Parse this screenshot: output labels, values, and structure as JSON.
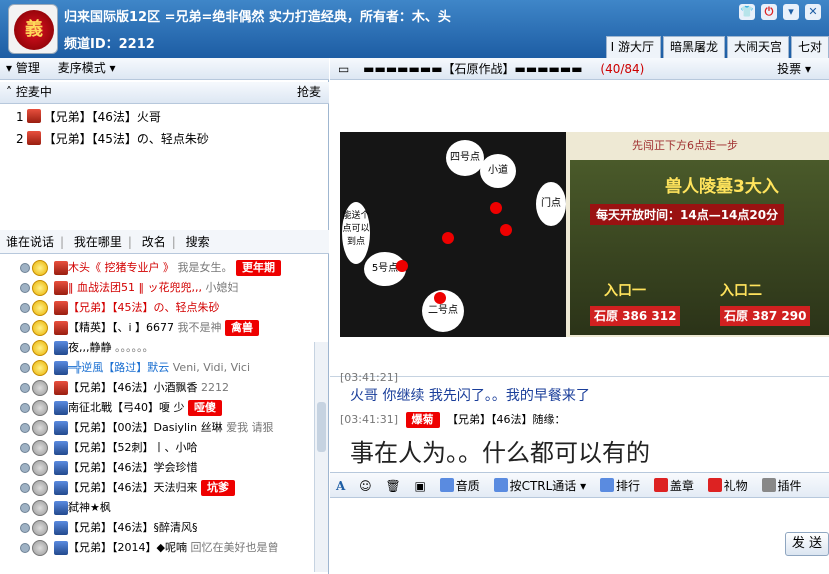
{
  "header": {
    "logo_text": "義",
    "channel_title": "归来国际版12区 =兄弟=绝非偶然 实力打造经典，所有者：木、头",
    "channel_id_label": "频道ID：2212",
    "window_buttons": [
      "shirt-icon",
      "power-icon",
      "minimize-icon",
      "close-icon"
    ],
    "tabs": [
      "I 游大厅",
      "暗黑屠龙",
      "大闹天宫",
      "七对"
    ]
  },
  "left": {
    "manage_label": "管理",
    "mode_label": "麦序模式 ▾",
    "mic_queue_label": "控麦中",
    "grab_mic_label": "抢麦",
    "mic_queue": [
      {
        "index": "1",
        "text": "【兄弟】【46法】火哥"
      },
      {
        "index": "2",
        "text": "【兄弟】【45法】の、轻点朱砂"
      }
    ],
    "chat_tabs": [
      "谁在说话",
      "我在哪里",
      "改名",
      "搜索"
    ],
    "users": [
      {
        "name": "木头《 挖猪专业户 》",
        "extra": "我是女生。",
        "badge": "更年期",
        "name_red": true
      },
      {
        "name": "‖ 血战法团51 ‖ ッ花兜兜,,,",
        "extra": "小媳妇",
        "name_red": true
      },
      {
        "name": "【兄弟】【45法】の、轻点朱砂",
        "extra": "",
        "name_red": true
      },
      {
        "name": "【精英】【、i 】6677",
        "extra": "我不是神",
        "badge": "禽兽"
      },
      {
        "name": "夜,,,静静",
        "extra": "。。。。。。"
      },
      {
        "name": "═╬逆風【路过】默云",
        "extra": "Veni, Vidi, Vici",
        "name_blue": true
      },
      {
        "name": "【兄弟】【46法】小酒飘香",
        "extra": "2212"
      },
      {
        "name": "南征北戰【弓40】嗄 少",
        "extra": "",
        "badge": "哑傻"
      },
      {
        "name": "【兄弟】【00法】Dasiylin 丝琳",
        "extra": "爱我 请狠"
      },
      {
        "name": "【兄弟】【52刺】丨、小哈",
        "extra": ""
      },
      {
        "name": "【兄弟】【46法】学会珍惜",
        "extra": ""
      },
      {
        "name": "【兄弟】【46法】天法归来",
        "extra": "",
        "badge": "坑爹"
      },
      {
        "name": "弑神★枫",
        "extra": ""
      },
      {
        "name": "【兄弟】【46法】§醉清风§",
        "extra": ""
      },
      {
        "name": "【兄弟】【2014】◆呢喃",
        "extra": "回忆在美好也是曾"
      }
    ]
  },
  "right": {
    "channel_header": "▬▬▬▬▬▬▬【石原作战】▬▬▬▬▬▬",
    "count": "(40/84)",
    "vote_label": "投票 ▾",
    "banner": {
      "spots": [
        "四号点",
        "小道",
        "门点",
        "能送个点可以到点",
        "5号点",
        "二号点"
      ],
      "tip": "先闯正下方6点走一步",
      "promo_title": "兽人陵墓3大入",
      "promo_time": "每天开放时间：14点—14点20分",
      "entry1": "入口一",
      "entry2": "入口二",
      "coords1": "石原 386 312",
      "coords2": "石原 387 290"
    },
    "chat": {
      "line1_time": "[03:41:21]",
      "line1_text": "火哥  你继续   我先闪了。。我的早餐来了",
      "line2_time": "[03:41:31]",
      "line2_badge": "爆菊",
      "line2_name": "【兄弟】【46法】随缘：",
      "line2_text": "事在人为。。什么都可以有的"
    },
    "toolbar": [
      "音质",
      "按CTRL通话 ▾",
      "排行",
      "盖章",
      "礼物",
      "插件"
    ],
    "send_label": "发 送"
  }
}
